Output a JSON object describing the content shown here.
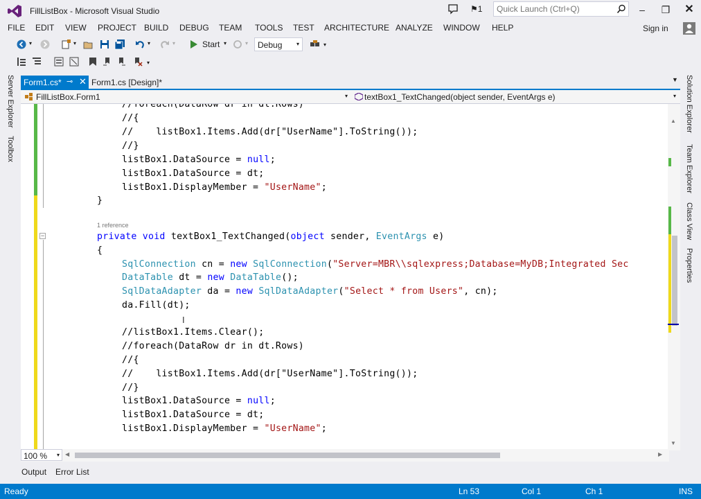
{
  "window": {
    "title": "FillListBox - Microsoft Visual Studio",
    "notification_count": "1",
    "quick_launch_placeholder": "Quick Launch (Ctrl+Q)"
  },
  "menu": [
    "FILE",
    "EDIT",
    "VIEW",
    "PROJECT",
    "BUILD",
    "DEBUG",
    "TEAM",
    "TOOLS",
    "TEST",
    "ARCHITECTURE",
    "ANALYZE",
    "WINDOW",
    "HELP"
  ],
  "account": {
    "sign_in": "Sign in"
  },
  "toolbar": {
    "start_label": "Start",
    "config": "Debug"
  },
  "left_panels": [
    "Server Explorer",
    "Toolbox"
  ],
  "right_panels": [
    "Solution Explorer",
    "Team Explorer",
    "Class View",
    "Properties"
  ],
  "tabs": [
    {
      "label": "Form1.cs*",
      "active": true
    },
    {
      "label": "Form1.cs [Design]*",
      "active": false
    }
  ],
  "navbar": {
    "class_scope": "FillListBox.Form1",
    "member_scope": "textBox1_TextChanged(object sender, EventArgs e)"
  },
  "code": {
    "l1": "//foreach(DataRow dr in dt.Rows)",
    "l2": "//{",
    "l3": "//    listBox1.Items.Add(dr[\"UserName\"].ToString());",
    "l4": "//}",
    "l5a": "listBox1.DataSource = ",
    "l5b": "null",
    "l6": "listBox1.DataSource = dt;",
    "l7a": "listBox1.DisplayMember = ",
    "l7b": "\"UserName\"",
    "l8": "}",
    "ref": "1 reference",
    "sig_kw1": "private void",
    "sig_name": " textBox1_TextChanged(",
    "sig_kw2": "object",
    "sig_mid": " sender, ",
    "sig_ty": "EventArgs",
    "sig_end": " e)",
    "l10": "{",
    "c1_ty": "SqlConnection",
    "c1_mid": " cn = ",
    "c1_kw": "new",
    "c1_ty2": "SqlConnection",
    "c1_st": "\"Server=MBR\\\\sqlexpress;Database=MyDB;Integrated Sec",
    "c2_ty": "DataTable",
    "c2_mid": " dt = ",
    "c2_ty2": "DataTable",
    "c2_end": "();",
    "c3_ty": "SqlDataAdapter",
    "c3_mid": " da = ",
    "c3_ty2": "SqlDataAdapter",
    "c3_st": "\"Select * from Users\"",
    "c3_end": ", cn);",
    "c4": "da.Fill(dt);",
    "c5": "//listBox1.Items.Clear();",
    "c6": "//foreach(DataRow dr in dt.Rows)",
    "c7": "//{",
    "c8": "//    listBox1.Items.Add(dr[\"UserName\"].ToString());",
    "c9": "//}",
    "c10a": "listBox1.DataSource = ",
    "c10b": "null",
    "c11": "listBox1.DataSource = dt;",
    "c12a": "listBox1.DisplayMember = ",
    "c12b": "\"UserName\""
  },
  "zoom": "100 %",
  "bottom_tabs": [
    "Output",
    "Error List"
  ],
  "status": {
    "state": "Ready",
    "ln": "Ln 53",
    "col": "Col 1",
    "ch": "Ch 1",
    "mode": "INS"
  },
  "colors": {
    "accent": "#007acc",
    "keyword": "#0000ff",
    "type": "#2b91af",
    "string": "#a31515",
    "comment": "#008000"
  }
}
